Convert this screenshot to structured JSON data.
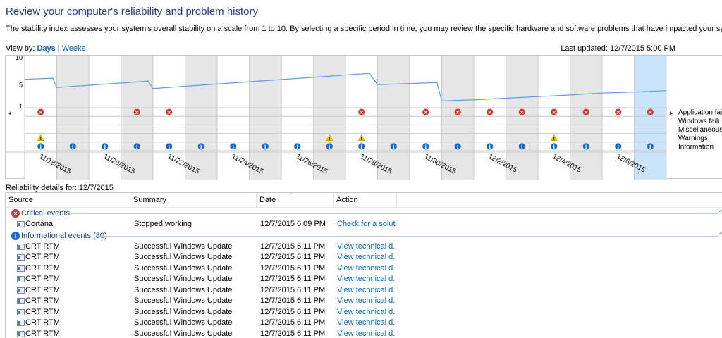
{
  "page": {
    "title": "Review your computer's reliability and problem history",
    "description": "The stability index assesses your system's overall stability on a scale from 1 to 10. By selecting a specific period in time, you may review the specific hardware and software problems that have impacted your system."
  },
  "view_by": {
    "label": "View by:",
    "days": "Days",
    "separator": "|",
    "weeks": "Weeks",
    "selected": "Days"
  },
  "last_updated": "Last updated: 12/7/2015 5:00 PM",
  "colors": {
    "title": "#1e3f8a",
    "link": "#0066cc",
    "stability_line": "#5a9be6",
    "selected_column": "#cce4fb",
    "shaded_column": "#e6e6e6",
    "critical": "#d9342b",
    "warning": "#f2c400",
    "info": "#1b6ac9"
  },
  "chart_data": {
    "type": "line",
    "y_ticks": [
      "10",
      "5",
      "1"
    ],
    "ylim": [
      1,
      10
    ],
    "columns": 20,
    "selected_column": 19,
    "date_labels": [
      "11/18/2015",
      "11/20/2015",
      "11/22/2015",
      "11/24/2015",
      "11/26/2015",
      "11/28/2015",
      "11/30/2015",
      "12/2/2015",
      "12/4/2015",
      "12/6/2015"
    ],
    "stability_points": [
      [
        0.0,
        6.0
      ],
      [
        0.88,
        6.2
      ],
      [
        1.0,
        4.5
      ],
      [
        3.85,
        5.65
      ],
      [
        4.0,
        4.3
      ],
      [
        10.75,
        7.1
      ],
      [
        11.0,
        5.0
      ],
      [
        12.85,
        5.4
      ],
      [
        13.0,
        2.0
      ],
      [
        14.0,
        2.2
      ],
      [
        15.0,
        2.5
      ],
      [
        16.0,
        2.8
      ],
      [
        17.0,
        3.1
      ],
      [
        18.0,
        3.45
      ],
      [
        19.0,
        3.65
      ],
      [
        20.0,
        3.9
      ]
    ],
    "event_rows": [
      "Application failures",
      "Windows failures",
      "Miscellaneous failures",
      "Warnings",
      "Information"
    ],
    "critical_columns": [
      1,
      4,
      5,
      11,
      13,
      14,
      15,
      16,
      17,
      18,
      19,
      20
    ],
    "warning_columns": [
      1,
      10,
      11,
      17
    ],
    "information_columns": [
      1,
      2,
      3,
      4,
      5,
      6,
      7,
      8,
      9,
      10,
      11,
      12,
      13,
      14,
      15,
      16,
      17,
      18,
      19,
      20
    ]
  },
  "details": {
    "label": "Reliability details for: 12/7/2015",
    "columns": [
      "Source",
      "Summary",
      "Date",
      "Action"
    ],
    "groups": [
      {
        "label": "Critical events",
        "type": "critical",
        "rows": [
          {
            "source": "Cortana",
            "summary": "Stopped working",
            "date": "12/7/2015 6:09 PM",
            "action": "Check for a soluti..."
          }
        ]
      },
      {
        "label": "Informational events (80)",
        "type": "info",
        "rows": [
          {
            "source": "CRT RTM",
            "summary": "Successful Windows Update",
            "date": "12/7/2015 6:11 PM",
            "action": "View  technical d..."
          },
          {
            "source": "CRT RTM",
            "summary": "Successful Windows Update",
            "date": "12/7/2015 6:11 PM",
            "action": "View  technical d..."
          },
          {
            "source": "CRT RTM",
            "summary": "Successful Windows Update",
            "date": "12/7/2015 6:11 PM",
            "action": "View  technical d..."
          },
          {
            "source": "CRT RTM",
            "summary": "Successful Windows Update",
            "date": "12/7/2015 6:11 PM",
            "action": "View  technical d..."
          },
          {
            "source": "CRT RTM",
            "summary": "Successful Windows Update",
            "date": "12/7/2015 6:11 PM",
            "action": "View  technical d..."
          },
          {
            "source": "CRT RTM",
            "summary": "Successful Windows Update",
            "date": "12/7/2015 6:11 PM",
            "action": "View  technical d..."
          },
          {
            "source": "CRT RTM",
            "summary": "Successful Windows Update",
            "date": "12/7/2015 6:11 PM",
            "action": "View  technical d..."
          },
          {
            "source": "CRT RTM",
            "summary": "Successful Windows Update",
            "date": "12/7/2015 6:11 PM",
            "action": "View  technical d..."
          },
          {
            "source": "CRT RTM",
            "summary": "Successful Windows Update",
            "date": "12/7/2015 6:11 PM",
            "action": "View  technical d..."
          }
        ]
      }
    ]
  }
}
